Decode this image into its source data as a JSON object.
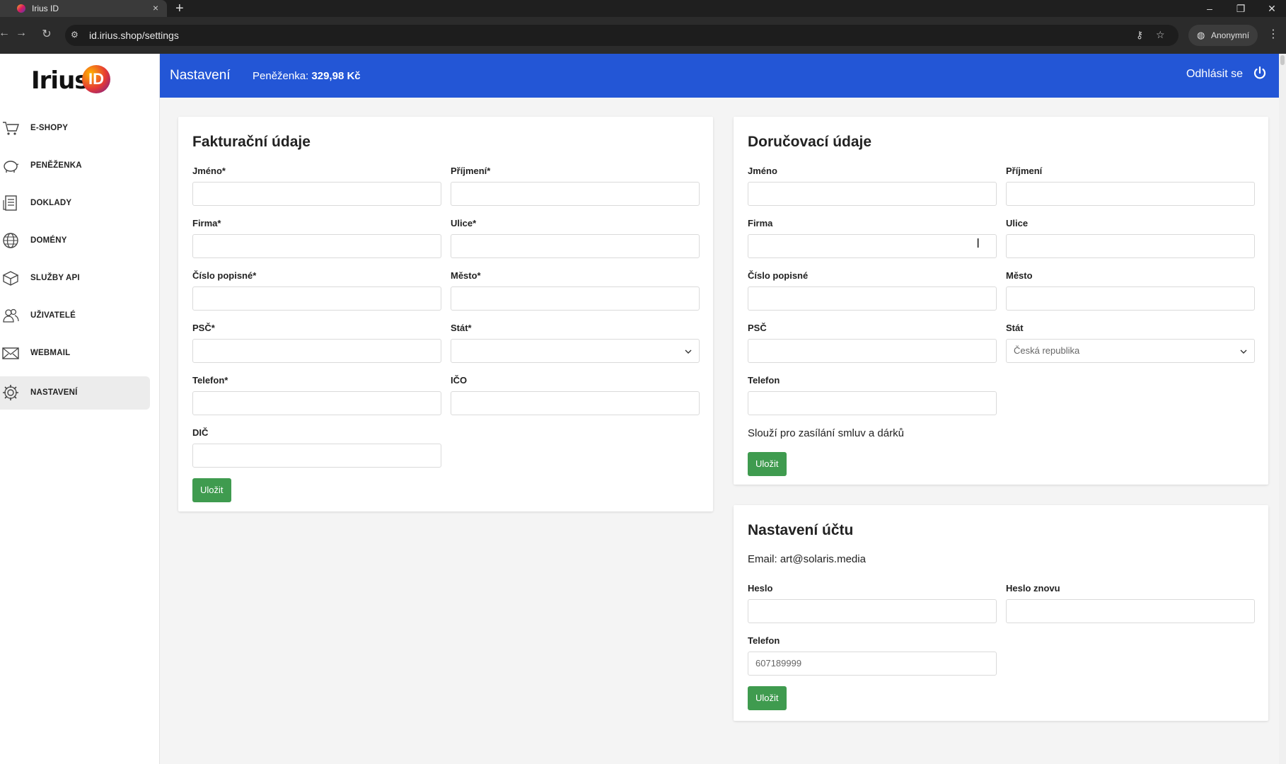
{
  "browser": {
    "tab_title": "Irius ID",
    "tab_close": "×",
    "new_tab": "+",
    "url": "id.irius.shop/settings",
    "incognito_label": "Anonymní",
    "window_controls": {
      "minimize": "–",
      "restore": "❐",
      "close": "✕"
    }
  },
  "sidebar": {
    "logo_text": "Irius",
    "logo_badge": "ID",
    "items": [
      {
        "label": "E-SHOPY",
        "icon": "cart-icon"
      },
      {
        "label": "PENĚŽENKA",
        "icon": "piggy-bank-icon"
      },
      {
        "label": "DOKLADY",
        "icon": "receipt-icon"
      },
      {
        "label": "DOMÉNY",
        "icon": "globe-icon"
      },
      {
        "label": "SLUŽBY API",
        "icon": "box-icon"
      },
      {
        "label": "UŽIVATELÉ",
        "icon": "users-icon"
      },
      {
        "label": "WEBMAIL",
        "icon": "envelope-icon"
      },
      {
        "label": "NASTAVENÍ",
        "icon": "gear-icon",
        "active": true
      }
    ]
  },
  "header": {
    "title": "Nastavení",
    "wallet_label": "Peněženka:",
    "wallet_amount": "329,98 Kč",
    "logout": "Odhlásit se",
    "accent_color": "#2356d6"
  },
  "billing": {
    "title": "Fakturační údaje",
    "labels": {
      "first_name": "Jméno*",
      "last_name": "Příjmení*",
      "company": "Firma*",
      "street": "Ulice*",
      "house_number": "Číslo popisné*",
      "city": "Město*",
      "zip": "PSČ*",
      "country": "Stát*",
      "phone": "Telefon*",
      "ico": "IČO",
      "dic": "DIČ"
    },
    "country_value": "",
    "save": "Uložit"
  },
  "delivery": {
    "title": "Doručovací údaje",
    "labels": {
      "first_name": "Jméno",
      "last_name": "Příjmení",
      "company": "Firma",
      "street": "Ulice",
      "house_number": "Číslo popisné",
      "city": "Město",
      "zip": "PSČ",
      "country": "Stát",
      "phone": "Telefon"
    },
    "country_value": "Česká republika",
    "note": "Slouží pro zasílání smluv a dárků",
    "save": "Uložit"
  },
  "account": {
    "title": "Nastavení účtu",
    "email_text": "Email: art@solaris.media",
    "labels": {
      "password": "Heslo",
      "password_again": "Heslo znovu",
      "phone": "Telefon"
    },
    "phone_placeholder": "607189999",
    "save": "Uložit"
  },
  "colors": {
    "save_button": "#3f9b4f",
    "header": "#2356d6"
  }
}
